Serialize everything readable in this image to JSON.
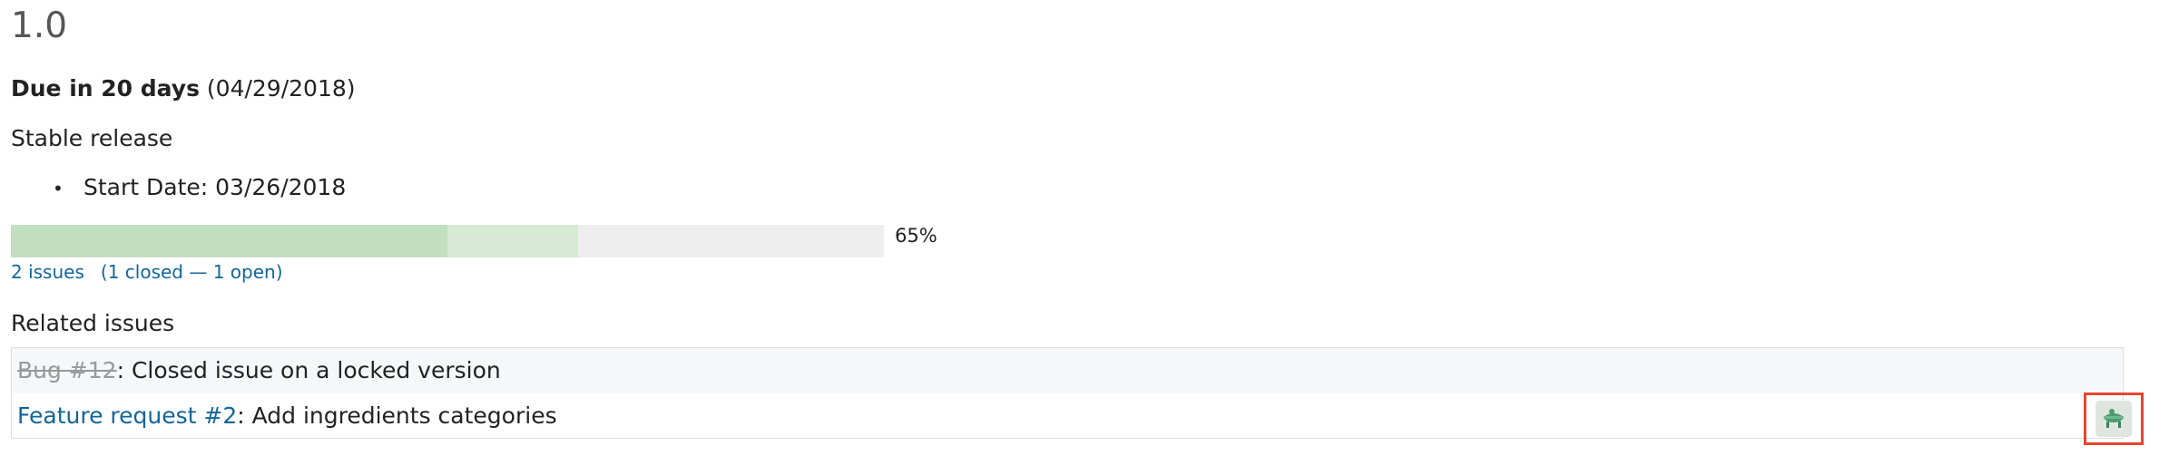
{
  "version": {
    "title": "1.0",
    "due_label": "Due in 20 days",
    "due_date": "(04/29/2018)",
    "description": "Stable release",
    "start_date": "Start Date: 03/26/2018"
  },
  "progress": {
    "closed_fraction": 0.5,
    "done_fraction": 0.65,
    "percent_label": "65%",
    "issues_link": "2 issues",
    "open_paren": "(",
    "closed_link": "1 closed",
    "separator": " — ",
    "open_link": "1 open",
    "close_paren": ")",
    "colors": {
      "closed": "#c2dfc0",
      "done": "#d6ead4",
      "todo": "#eeeeee"
    }
  },
  "related": {
    "heading": "Related issues",
    "issues": [
      {
        "link": "Bug #12",
        "subject": ": Closed issue on a locked version",
        "closed": true
      },
      {
        "link": "Feature request #2",
        "subject": ": Add ingredients categories",
        "closed": false,
        "assignee_icon": "avatar-icon"
      }
    ]
  },
  "colors": {
    "link": "#116699",
    "highlight_border": "#e8452f"
  }
}
